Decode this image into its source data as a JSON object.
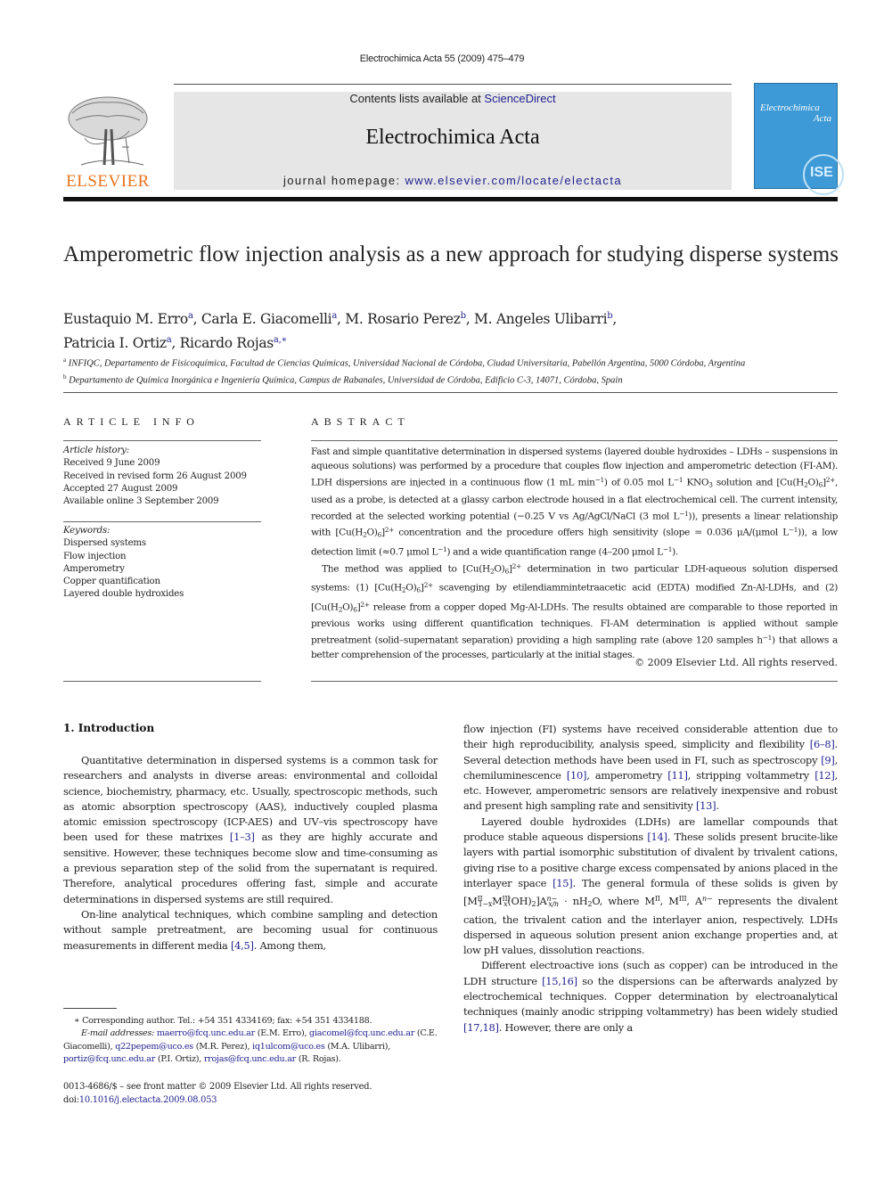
{
  "header": {
    "running_citation": "Electrochimica Acta 55 (2009) 475–479",
    "contents_prefix": "Contents lists available at ",
    "contents_link": "ScienceDirect",
    "journal_name": "Electrochimica Acta",
    "homepage_prefix": "journal homepage: ",
    "homepage_url": "www.elsevier.com/locate/electacta",
    "publisher_logo_text": "ELSEVIER",
    "cover_title_line1": "Electrochimica",
    "cover_title_line2": "Acta",
    "cover_seal_text": "ISE"
  },
  "article": {
    "title": "Amperometric flow injection analysis as a new approach for studying disperse systems",
    "authors": [
      {
        "name": "Eustaquio M. Erro",
        "aff": "a"
      },
      {
        "name": "Carla E. Giacomelli",
        "aff": "a"
      },
      {
        "name": "M. Rosario Perez",
        "aff": "b"
      },
      {
        "name": "M. Angeles Ulibarri",
        "aff": "b"
      },
      {
        "name": "Patricia I. Ortiz",
        "aff": "a"
      },
      {
        "name": "Ricardo Rojas",
        "aff": "a,∗"
      }
    ],
    "affiliations": [
      {
        "key": "a",
        "text": "INFIQC, Departamento de Fisicoquímica, Facultad de Ciencias Químicas, Universidad Nacional de Córdoba, Ciudad Universitaria, Pabellón Argentina, 5000 Córdoba, Argentina"
      },
      {
        "key": "b",
        "text": "Departamento de Química Inorgánica e Ingeniería Química, Campus de Rabanales, Universidad de Córdoba, Edificio C-3, 14071, Córdoba, Spain"
      }
    ]
  },
  "article_info": {
    "heading": "ARTICLE INFO",
    "history_label": "Article history:",
    "history": [
      "Received 9 June 2009",
      "Received in revised form 26 August 2009",
      "Accepted 27 August 2009",
      "Available online 3 September 2009"
    ],
    "keywords_label": "Keywords:",
    "keywords": [
      "Dispersed systems",
      "Flow injection",
      "Amperometry",
      "Copper quantification",
      "Layered double hydroxides"
    ]
  },
  "abstract": {
    "heading": "ABSTRACT",
    "p1": [
      "Fast and simple quantitative determination in dispersed systems (layered double hydroxides – LDHs – suspensions in aqueous solutions) was performed by a procedure that couples flow injection and amperometric detection (FI-AM). LDH dispersions are injected in a continuous flow (1 mL min",
      "−1",
      ") of 0.05 mol L",
      "−1",
      " KNO",
      "3",
      " solution and [Cu(H",
      "2",
      "O)",
      "6",
      "]",
      "2+",
      ", used as a probe, is detected at a glassy carbon electrode housed in a flat electrochemical cell. The current intensity, recorded at the selected working potential (−0.25 V vs Ag/AgCl/NaCl (3 mol L",
      "−1",
      ")), presents a linear relationship with [Cu(H",
      "2",
      "O)",
      "6",
      "]",
      "2+",
      " concentration and the procedure offers high sensitivity (slope = 0.036 μA/(μmol L",
      "−1",
      ")), a low detection limit (≈0.7 μmol L",
      "−1",
      ") and a wide quantification range (4–200 μmol L",
      "−1",
      ")."
    ],
    "p2": [
      "The method was applied to [Cu(H",
      "2",
      "O)",
      "6",
      "]",
      "2+",
      " determination in two particular LDH-aqueous solution dispersed systems: (1) [Cu(H",
      "2",
      "O)",
      "6",
      "]",
      "2+",
      " scavenging by etilendiammintetraacetic acid (EDTA) modified Zn-Al-LDHs, and (2) [Cu(H",
      "2",
      "O)",
      "6",
      "]",
      "2+",
      " release from a copper doped Mg-Al-LDHs. The results obtained are comparable to those reported in previous works using different quantification techniques. FI-AM determination is applied without sample pretreatment (solid–supernatant separation) providing a high sampling rate (above 120 samples h",
      "−1",
      ") that allows a better comprehension of the processes, particularly at the initial stages."
    ],
    "copyright": "© 2009 Elsevier Ltd. All rights reserved."
  },
  "introduction": {
    "heading": "1.  Introduction",
    "p1": {
      "a": "Quantitative determination in dispersed systems is a common task for researchers and analysts in diverse areas: environmental and colloidal science, biochemistry, pharmacy, etc. Usually, spectroscopic methods, such as atomic absorption spectroscopy (AAS), inductively coupled plasma atomic emission spectroscopy (ICP-AES) and UV–vis spectroscopy have been used for these matrixes ",
      "ref1": "[1–3]",
      "b": " as they are highly accurate and sensitive. However, these techniques become slow and time-consuming as a previous separation step of the solid from the supernatant is required. Therefore, analytical procedures offering fast, simple and accurate determinations in dispersed systems are still required."
    },
    "p2": {
      "a": "On-line analytical techniques, which combine sampling and detection without sample pretreatment, are becoming usual for continuous measurements in different media ",
      "ref1": "[4,5]",
      "b": ". Among them,"
    },
    "p3": {
      "a": "flow injection (FI) systems have received considerable attention due to their high reproducibility, analysis speed, simplicity and flexibility ",
      "ref1": "[6–8]",
      "b": ". Several detection methods have been used in FI, such as spectroscopy ",
      "ref2": "[9]",
      "c": ", chemiluminescence ",
      "ref3": "[10]",
      "d": ", amperometry ",
      "ref4": "[11]",
      "e": ", stripping voltammetry ",
      "ref5": "[12]",
      "f": ", etc. However, amperometric sensors are relatively inexpensive and robust and present high sampling rate and sensitivity ",
      "ref6": "[13]",
      "g": "."
    },
    "p4": {
      "a": "Layered double hydroxides (LDHs) are lamellar compounds that produce stable aqueous dispersions ",
      "ref1": "[14]",
      "b": ". These solids present brucite-like layers with partial isomorphic substitution of divalent by trivalent cations, giving rise to a positive charge excess compensated by anions placed in the interlayer space ",
      "ref2": "[15]",
      "c": ". The general formula of these solids is given by [M",
      "f1": "II",
      "f1b": "1−x",
      "f2": "M",
      "f3": "III",
      "f3b": "x",
      "f4": "(OH)",
      "f4b": "2",
      "f5": "]A",
      "f6": "n−",
      "f6b": "x/n",
      "f7": " · nH",
      "f7b": "2",
      "f8": "O, where M",
      "f9": "II",
      "f10": ", M",
      "f11": "III",
      "f12": ", A",
      "f13": "n−",
      "d": " represents the divalent cation, the trivalent cation and the interlayer anion, respectively. LDHs dispersed in aqueous solution present anion exchange properties and, at low pH values, dissolution reactions."
    },
    "p5": {
      "a": "Different electroactive ions (such as copper) can be introduced in the LDH structure ",
      "ref1": "[15,16]",
      "b": " so the dispersions can be afterwards analyzed by electrochemical techniques. Copper determination by electroanalytical techniques (mainly anodic stripping voltammetry) has been widely studied ",
      "ref2": "[17,18]",
      "c": ". However, there are only a"
    }
  },
  "footnotes": {
    "corresponding": "∗  Corresponding author. Tel.: +54 351 4334169; fax: +54 351 4334188.",
    "email_label": "E-mail addresses:",
    "emails": [
      {
        "addr": "maerro@fcq.unc.edu.ar",
        "who": " (E.M. Erro), "
      },
      {
        "addr": "giacomel@fcq.unc.edu.ar",
        "who": " (C.E. Giacomelli), "
      },
      {
        "addr": "q22pepem@uco.es",
        "who": " (M.R. Perez), "
      },
      {
        "addr": "iq1ulcom@uco.es",
        "who": " (M.A. Ulibarri), "
      },
      {
        "addr": "portiz@fcq.unc.edu.ar",
        "who": " (P.I. Ortiz), "
      },
      {
        "addr": "rrojas@fcq.unc.edu.ar",
        "who": " (R. Rojas)."
      }
    ],
    "front_matter": "0013-4686/$ – see front matter © 2009 Elsevier Ltd. All rights reserved.",
    "doi_label": "doi:",
    "doi": "10.1016/j.electacta.2009.08.053"
  },
  "colors": {
    "link": "#22228f",
    "elsevier_orange": "#e8731e",
    "banner_bg": "#e6e6e6",
    "cover_blue": "#3d9ad6"
  }
}
